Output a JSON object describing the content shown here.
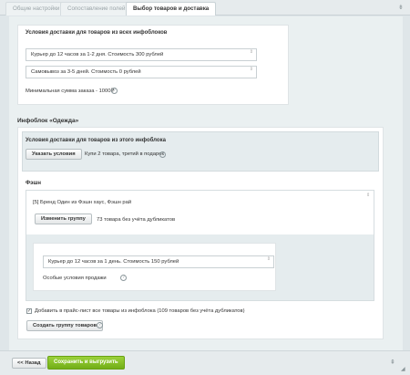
{
  "tabs": [
    {
      "label": "Общие настройки"
    },
    {
      "label": "Сопоставление полей"
    },
    {
      "label": "Выбор товаров и доставка"
    }
  ],
  "global_delivery": {
    "title": "Условия доставки для товаров из всех инфоблоков",
    "conditions": [
      "Курьер до 12 часов за 1-2 дня. Стоимость 300 рублей",
      "Самовывоз за 3-5 дней. Стоимость 0 рублей"
    ],
    "min_order": "Минимальная сумма заказа - 1000₽"
  },
  "infoblock": {
    "title": "Инфоблок «Одежда»",
    "delivery_title": "Условия доставки для товаров из этого инфоблока",
    "specify_button": "Указать условия",
    "promo_text": "Купи 2 товара, третий в подарок",
    "group_label": "Фэшн",
    "group_value": "[5] Бренд Один из Фэшн хаус, Фэшн рай",
    "change_group_button": "Изменить группу",
    "group_count": "73 товара без учёта дубликатов",
    "group_condition": "Курьер до 12 часов за 1 день. Стоимость 150 рублей",
    "special_conditions": "Особые условия продажи",
    "add_all_checkbox": "Добавить в прайс-лист все товары из инфоблока (109 товаров без учёта дубликатов)",
    "add_all_checked": true,
    "create_group_button": "Создать группу товаров"
  },
  "footer": {
    "back_button": "<< Назад",
    "save_button": "Сохранить и выгрузить"
  }
}
